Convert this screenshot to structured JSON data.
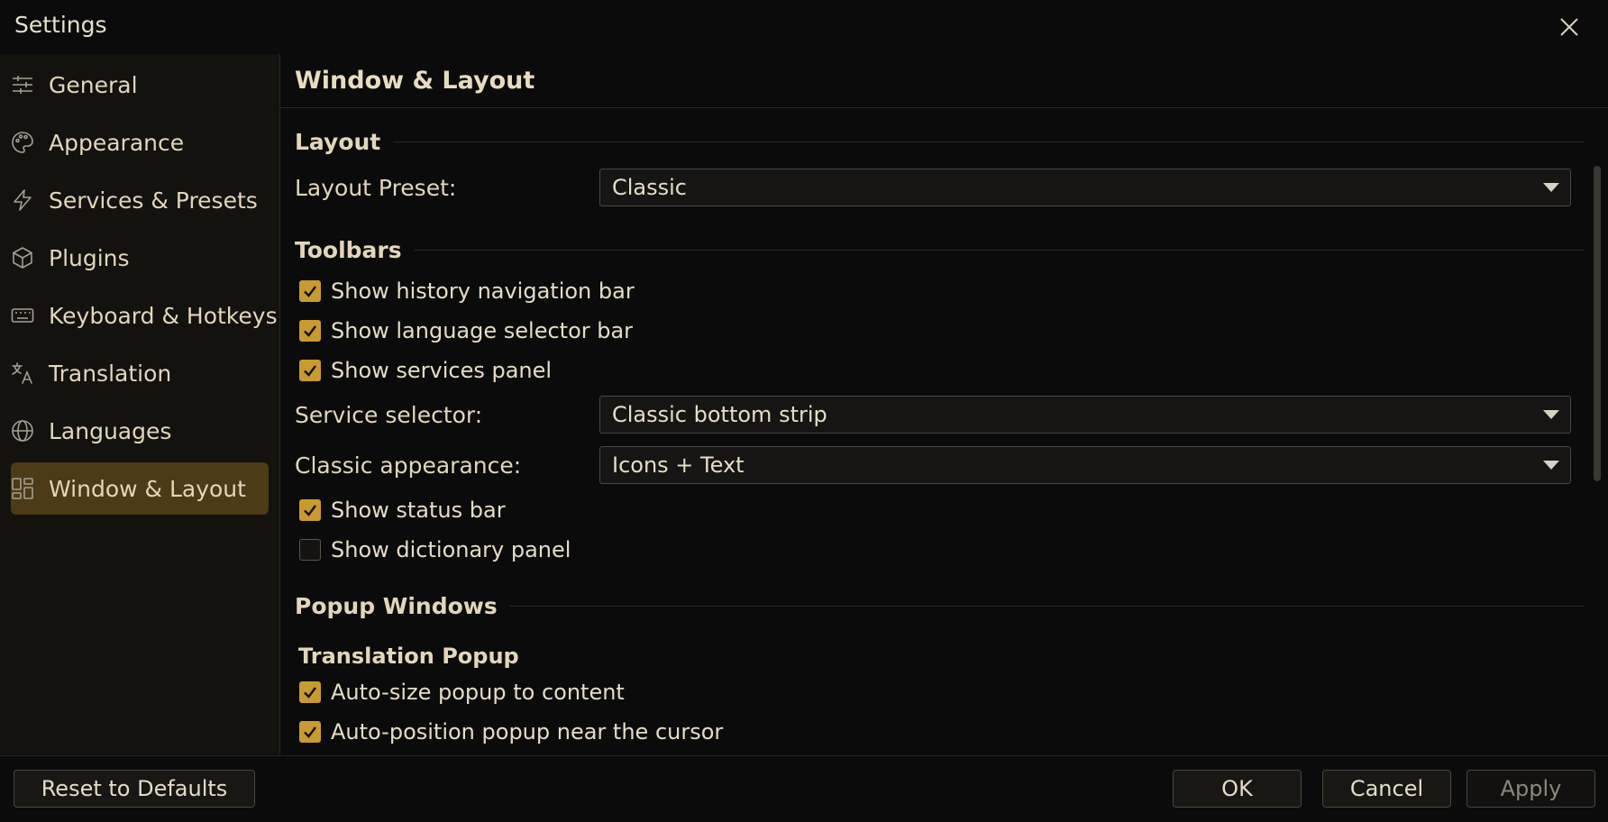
{
  "window": {
    "title": "Settings"
  },
  "sidebar": {
    "items": [
      {
        "label": "General",
        "icon": "sliders-icon"
      },
      {
        "label": "Appearance",
        "icon": "palette-icon"
      },
      {
        "label": "Services & Presets",
        "icon": "lightning-icon"
      },
      {
        "label": "Plugins",
        "icon": "cube-icon"
      },
      {
        "label": "Keyboard & Hotkeys",
        "icon": "keyboard-icon"
      },
      {
        "label": "Translation",
        "icon": "translate-icon"
      },
      {
        "label": "Languages",
        "icon": "globe-icon"
      },
      {
        "label": "Window & Layout",
        "icon": "layout-grid-icon",
        "active": true
      }
    ]
  },
  "main": {
    "title": "Window & Layout",
    "sections": {
      "layout": {
        "label": "Layout",
        "preset_label": "Layout Preset:",
        "preset_value": "Classic"
      },
      "toolbars": {
        "label": "Toolbars",
        "history_nav": {
          "label": "Show history navigation bar",
          "checked": true
        },
        "language_selector": {
          "label": "Show language selector bar",
          "checked": true
        },
        "services_panel": {
          "label": "Show services panel",
          "checked": true
        },
        "service_selector_label": "Service selector:",
        "service_selector_value": "Classic bottom strip",
        "classic_appearance_label": "Classic appearance:",
        "classic_appearance_value": "Icons + Text",
        "status_bar": {
          "label": "Show status bar",
          "checked": true
        },
        "dictionary_panel": {
          "label": "Show dictionary panel",
          "checked": false
        }
      },
      "popup": {
        "label": "Popup Windows",
        "sub_title": "Translation Popup",
        "auto_size": {
          "label": "Auto-size popup to content",
          "checked": true
        },
        "auto_position": {
          "label": "Auto-position popup near the cursor",
          "checked": true
        }
      }
    }
  },
  "footer": {
    "reset_label": "Reset to Defaults",
    "ok_label": "OK",
    "cancel_label": "Cancel",
    "apply_label": "Apply"
  },
  "colors": {
    "accent": "#c99a31",
    "active_nav": "#4d3a16",
    "background": "#0b0b0b",
    "sidebar": "#13120f"
  }
}
